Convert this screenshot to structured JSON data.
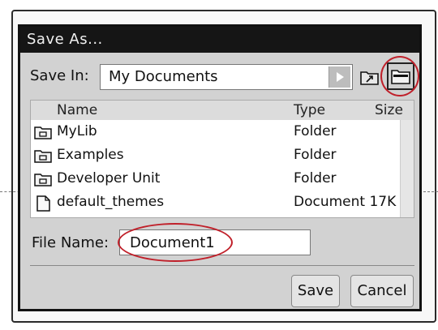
{
  "dialog": {
    "title": "Save As...",
    "save_in_label": "Save In:",
    "save_in_value": "My Documents",
    "icons": {
      "up_folder": "folder-up-icon",
      "new_folder": "new-folder-icon"
    }
  },
  "file_list": {
    "columns": {
      "name": "Name",
      "type": "Type",
      "size": "Size"
    },
    "items": [
      {
        "name": "MyLib",
        "type": "Folder",
        "icon": "folder-icon"
      },
      {
        "name": "Examples",
        "type": "Folder",
        "icon": "folder-icon"
      },
      {
        "name": "Developer Unit",
        "type": "Folder",
        "icon": "folder-icon"
      },
      {
        "name": "default_themes",
        "type": "Document 17K",
        "icon": "document-icon"
      }
    ]
  },
  "file_name": {
    "label": "File Name:",
    "value": "Document1"
  },
  "buttons": {
    "save": "Save",
    "cancel": "Cancel"
  },
  "colors": {
    "annotation": "#c0202a",
    "titlebar": "#151515",
    "dialog_bg": "#d2d2d2"
  }
}
